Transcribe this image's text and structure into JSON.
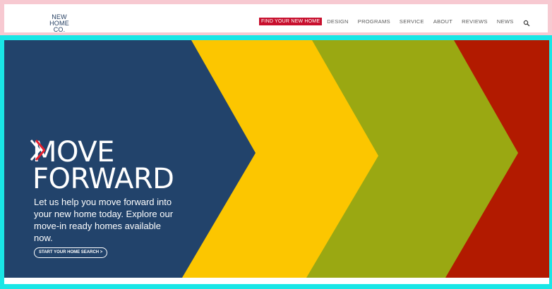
{
  "header": {
    "logo_lines": [
      "NEW",
      "HOME",
      "CO."
    ],
    "nav": [
      {
        "label": "FIND YOUR NEW HOME",
        "primary": true
      },
      {
        "label": "DESIGN"
      },
      {
        "label": "PROGRAMS"
      },
      {
        "label": "SERVICE"
      },
      {
        "label": "ABOUT"
      },
      {
        "label": "REVIEWS"
      },
      {
        "label": "NEWS"
      }
    ],
    "search_icon": "search-icon"
  },
  "hero": {
    "title_line1": "MOVE",
    "title_line2": "FORWARD",
    "body": "Let us help you move forward into your new home today. Explore our move-in ready homes available now.",
    "cta_label": "START YOUR HOME SEARCH >",
    "colors": {
      "navy": "#22436b",
      "yellow": "#fcc600",
      "olive": "#9aa812",
      "red": "#b21a00",
      "accent_red": "#e4202e",
      "frame": "#19e6e6"
    }
  }
}
